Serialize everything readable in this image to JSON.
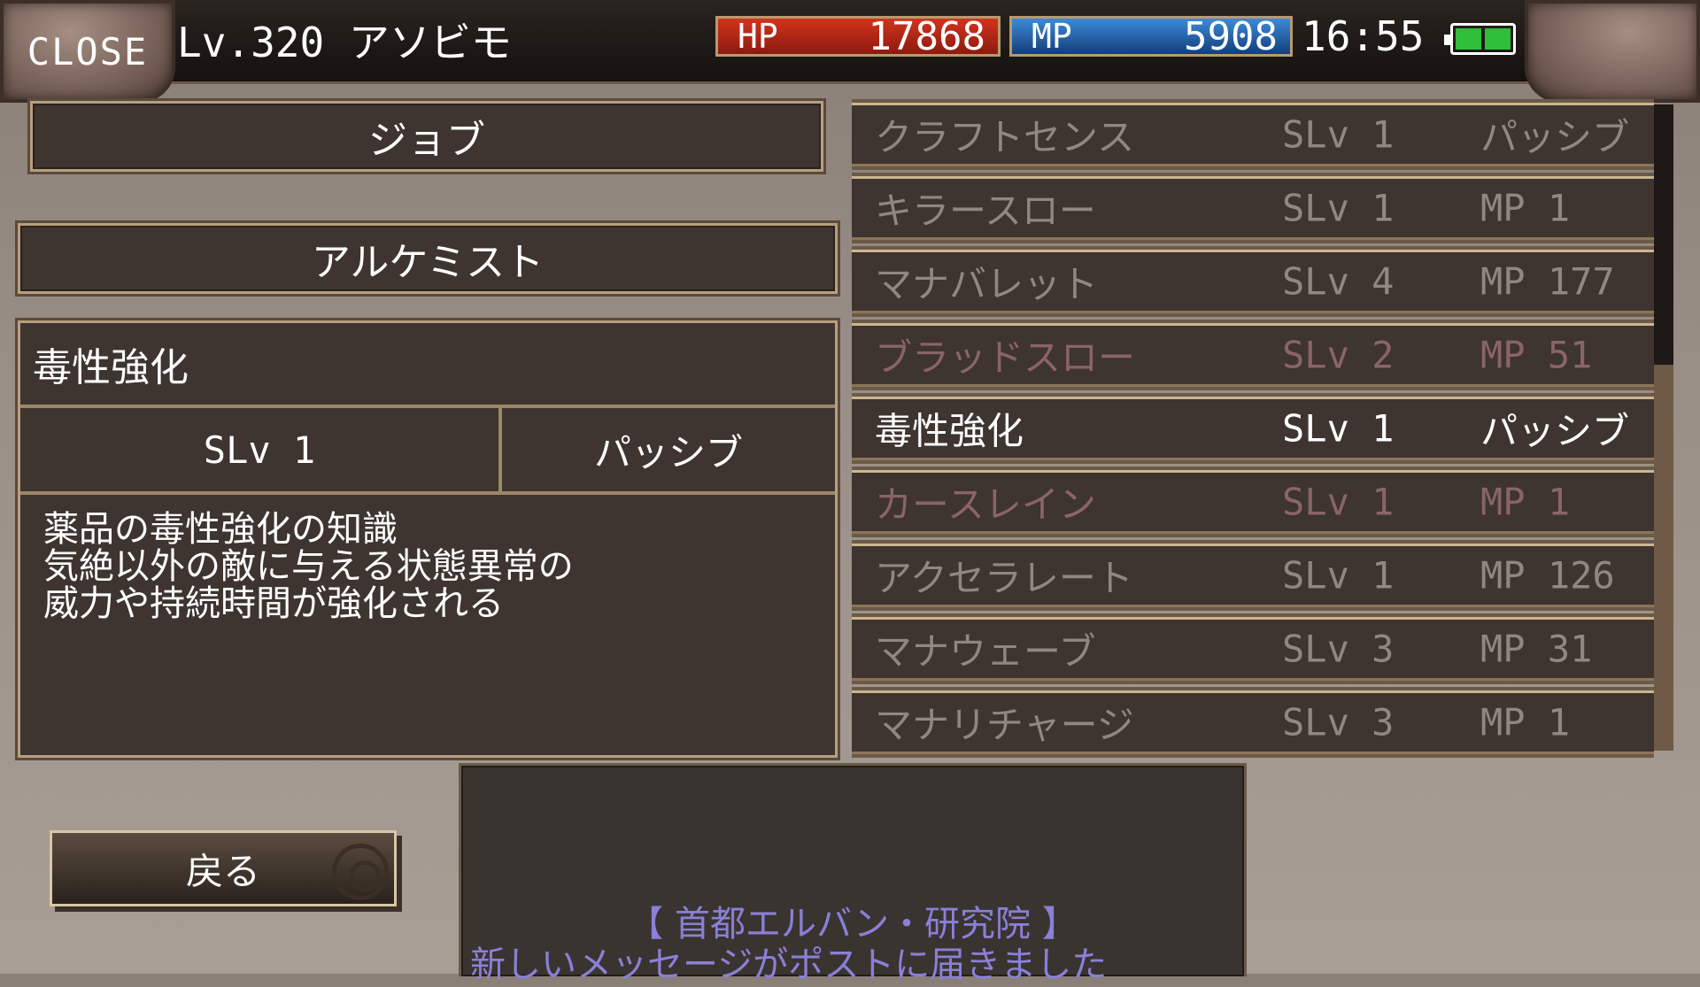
{
  "header": {
    "close_label": "CLOSE",
    "player": "Lv.320 アソビモ",
    "hp_label": "HP",
    "hp_value": "17868",
    "mp_label": "MP",
    "mp_value": "5908",
    "time": "16:55",
    "battery_icon": "battery-icon"
  },
  "job": {
    "header": "ジョブ",
    "name": "アルケミスト"
  },
  "detail": {
    "name": "毒性強化",
    "slv": "SLv 1",
    "kind": "パッシブ",
    "desc_lines": [
      "薬品の毒性強化の知識",
      "気絶以外の敵に与える状態異常の",
      "威力や持続時間が強化される"
    ]
  },
  "skills": [
    {
      "name": "クラフトセンス",
      "slv": "SLv 1",
      "cost": "パッシブ",
      "state": "normal"
    },
    {
      "name": "キラースロー",
      "slv": "SLv 1",
      "cost": "MP  1",
      "state": "normal"
    },
    {
      "name": "マナバレット",
      "slv": "SLv 4",
      "cost": "MP  177",
      "state": "normal"
    },
    {
      "name": "ブラッドスロー",
      "slv": "SLv 2",
      "cost": "MP  51",
      "state": "red"
    },
    {
      "name": "毒性強化",
      "slv": "SLv 1",
      "cost": "パッシブ",
      "state": "active"
    },
    {
      "name": "カースレイン",
      "slv": "SLv 1",
      "cost": "MP  1",
      "state": "red"
    },
    {
      "name": "アクセラレート",
      "slv": "SLv 1",
      "cost": "MP  126",
      "state": "normal"
    },
    {
      "name": "マナウェーブ",
      "slv": "SLv 3",
      "cost": "MP  31",
      "state": "normal"
    },
    {
      "name": "マナリチャージ",
      "slv": "SLv 3",
      "cost": "MP  1",
      "state": "normal"
    }
  ],
  "back_label": "戻る",
  "message": {
    "location": "【 首都エルバン・研究院 】",
    "text": "新しいメッセージがポストに届きました"
  }
}
